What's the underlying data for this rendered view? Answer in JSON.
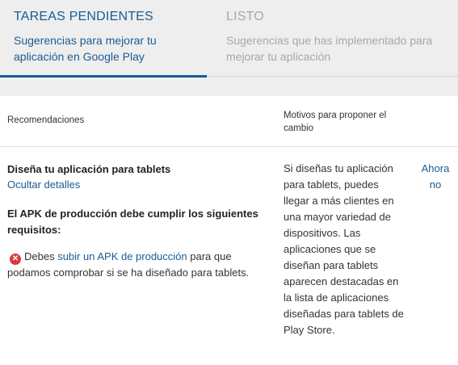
{
  "tabs": {
    "todo": {
      "title": "TAREAS PENDIENTES",
      "desc": "Sugerencias para mejorar tu aplicación en Google Play"
    },
    "done": {
      "title": "LISTO",
      "desc": "Sugerencias que has implementado para mejorar tu aplicación"
    }
  },
  "table": {
    "col_recommendations": "Recomendaciones",
    "col_reasons": "Motivos para proponer el cambio"
  },
  "recommendation": {
    "title": "Diseña tu aplicación para tablets",
    "hide_details": "Ocultar detalles",
    "requirements_heading": "El APK de producción debe cumplir los siguientes requisitos:",
    "requirement_prefix": "Debes",
    "requirement_link": "subir un APK de producción",
    "requirement_suffix": "para que podamos comprobar si se ha diseñado para tablets.",
    "reason": "Si diseñas tu aplicación para tablets, puedes llegar a más clientes en una mayor variedad de dispositivos. Las aplicaciones que se diseñan para tablets aparecen destacadas en la lista de aplicaciones diseñadas para tablets de Play Store.",
    "later_action": "Ahora no"
  },
  "icons": {
    "error": "error-circle-icon"
  },
  "colors": {
    "accent": "#1a5b94",
    "inactive": "#a8a8a8",
    "error": "#d9383a"
  }
}
